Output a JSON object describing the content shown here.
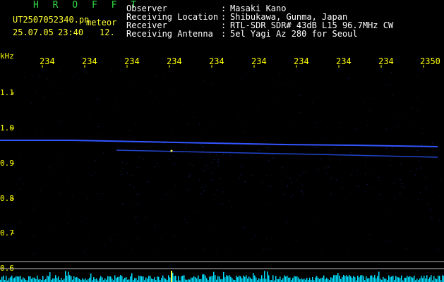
{
  "header": {
    "program": "H R O F F T",
    "filename": "UT2507052340.pn",
    "mode": "meteor",
    "date": "25.07.05",
    "time": "23:40",
    "count": "12.",
    "labels": {
      "observer": "Observer",
      "location": "Receiving Location",
      "receiver": "Receiver",
      "antenna": "Receiving Antenna"
    },
    "colon": ":",
    "values": {
      "observer": "Masaki Kano",
      "location": "Shibukawa, Gunma, Japan",
      "receiver": "RTL-SDR SDR# 43dB L15 96.7MHz CW",
      "antenna": "5el Yagi Az 280 for Seoul"
    }
  },
  "axis": {
    "unit": "kHz",
    "x_ticks": [
      "234",
      "234",
      "234",
      "234",
      "234",
      "234",
      "234",
      "234",
      "234",
      "2350"
    ],
    "y_labels": [
      "1.1",
      "1.0",
      "0.9",
      "0.8",
      "0.7",
      "0.6"
    ]
  },
  "colors": {
    "background": "#000000",
    "trace": "#3355ff",
    "noise": "#00e0ff",
    "label": "#ffff00",
    "title": "#33dd44"
  }
}
